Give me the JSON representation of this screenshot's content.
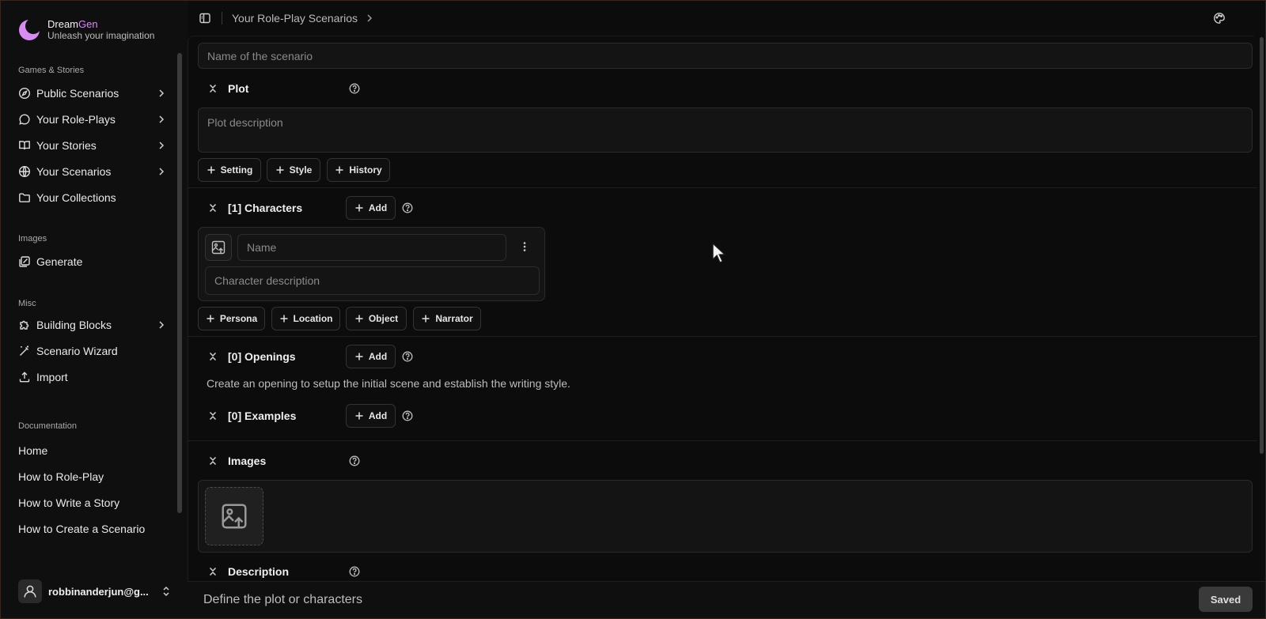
{
  "brand": {
    "name_part1": "Dream",
    "name_part2": "Gen",
    "tagline": "Unleash your imagination",
    "accent": "#d68cf0"
  },
  "sidebar": {
    "sections": [
      {
        "title": "Games & Stories"
      },
      {
        "title": "Images"
      },
      {
        "title": "Misc"
      },
      {
        "title": "Documentation"
      }
    ],
    "games": [
      {
        "label": "Public Scenarios",
        "icon": "compass-icon",
        "chevron": true
      },
      {
        "label": "Your Role-Plays",
        "icon": "chat-bubble-icon",
        "chevron": true
      },
      {
        "label": "Your Stories",
        "icon": "book-open-icon",
        "chevron": true
      },
      {
        "label": "Your Scenarios",
        "icon": "globe-icon",
        "chevron": true
      },
      {
        "label": "Your Collections",
        "icon": "folder-icon",
        "chevron": false
      }
    ],
    "images": [
      {
        "label": "Generate",
        "icon": "image-edit-icon"
      }
    ],
    "misc": [
      {
        "label": "Building Blocks",
        "icon": "puzzle-icon",
        "chevron": true
      },
      {
        "label": "Scenario Wizard",
        "icon": "magic-wand-icon"
      },
      {
        "label": "Import",
        "icon": "upload-icon"
      }
    ],
    "docs": [
      {
        "label": "Home"
      },
      {
        "label": "How to Role-Play"
      },
      {
        "label": "How to Write a Story"
      },
      {
        "label": "How to Create a Scenario"
      }
    ],
    "user": {
      "name": "robbinanderjun@g..."
    }
  },
  "topbar": {
    "breadcrumb": "Your Role-Play Scenarios"
  },
  "editor": {
    "name_placeholder": "Name of the scenario",
    "plot": {
      "title": "Plot",
      "placeholder": "Plot description"
    },
    "plot_buttons": [
      "Setting",
      "Style",
      "History"
    ],
    "characters": {
      "title": "[1] Characters",
      "add_label": "Add",
      "name_placeholder": "Name",
      "desc_placeholder": "Character description"
    },
    "char_buttons": [
      "Persona",
      "Location",
      "Object",
      "Narrator"
    ],
    "openings": {
      "title": "[0] Openings",
      "add_label": "Add",
      "hint": "Create an opening to setup the initial scene and establish the writing style."
    },
    "examples": {
      "title": "[0] Examples",
      "add_label": "Add"
    },
    "images": {
      "title": "Images"
    },
    "description": {
      "title": "Description"
    }
  },
  "bottombar": {
    "placeholder": "Define the plot or characters",
    "status": "Saved"
  }
}
